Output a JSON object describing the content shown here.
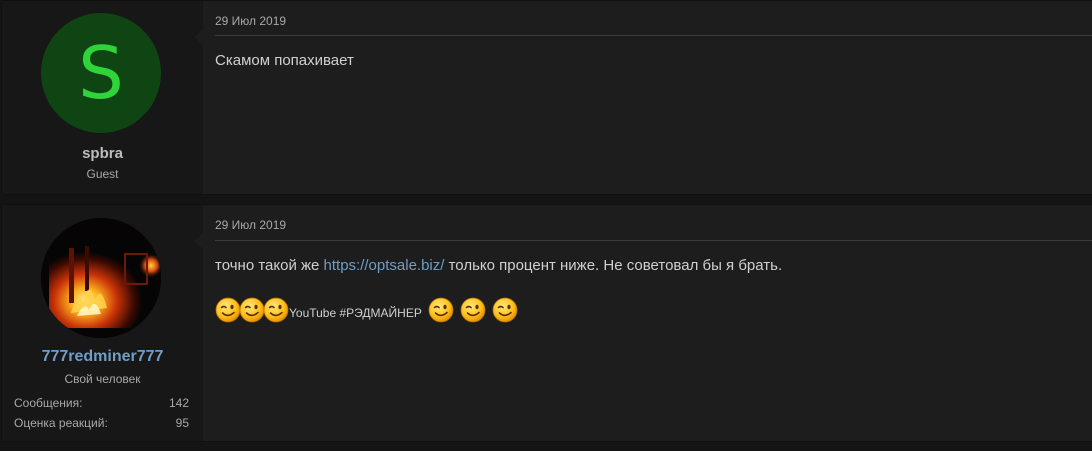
{
  "posts": [
    {
      "avatar_letter": "S",
      "username": "spbra",
      "user_title": "Guest",
      "date": "29 Июл 2019",
      "message": "Скамом попахивает"
    },
    {
      "username": "777redminer777",
      "user_title": "Свой человек",
      "stats": [
        {
          "label": "Сообщения:",
          "value": "142"
        },
        {
          "label": "Оценка реакций:",
          "value": "95"
        }
      ],
      "date": "29 Июл 2019",
      "message_before": "точно такой же ",
      "message_link": "https://optsale.biz/",
      "message_after": " только процент ниже. Не советовал бы я брать.",
      "signature_text": "YouTube #РЭДМАЙНЕР",
      "emoji_icon": "wink-emoji-icon"
    }
  ],
  "colors": {
    "username_link": "#6e9ec7",
    "avatar_bg": "#0f4512",
    "avatar_letter": "#2fd43a"
  }
}
